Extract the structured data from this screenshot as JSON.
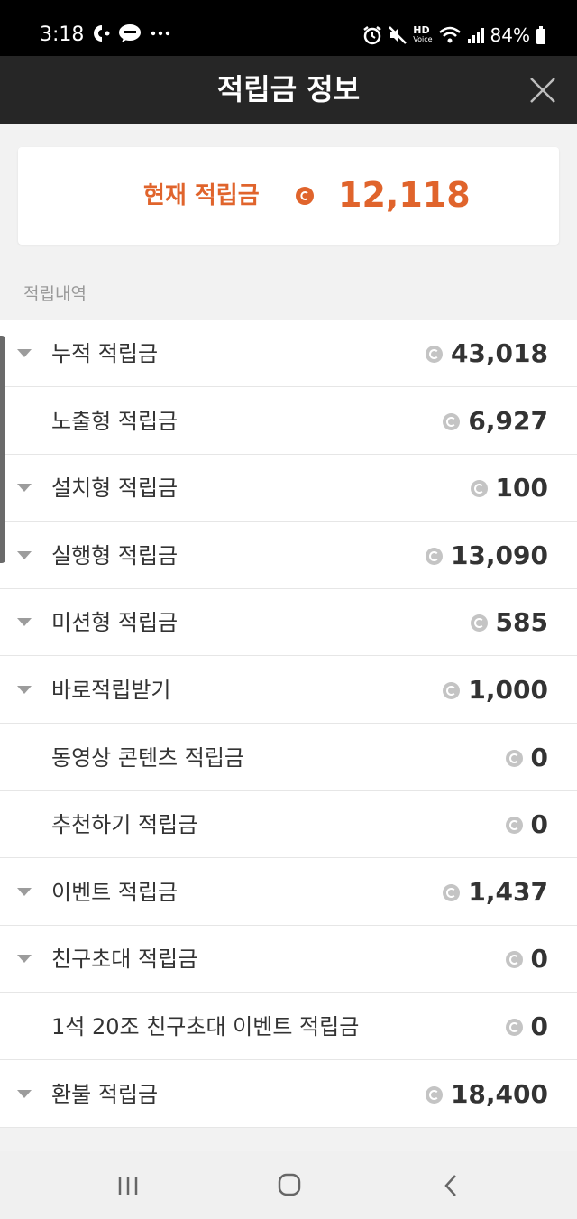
{
  "status_bar": {
    "time": "3:18",
    "battery": "84%",
    "icons": [
      "kakao-icon",
      "talk-icon",
      "more-icon",
      "alarm-icon",
      "mute-icon",
      "hd-voice-icon",
      "wifi-icon",
      "signal-icon",
      "battery-icon"
    ],
    "hd_top": "HD",
    "hd_bottom": "Voice"
  },
  "header": {
    "title": "적립금 정보",
    "close_icon": "close-icon"
  },
  "current": {
    "label": "현재 적립금",
    "amount": "12,118",
    "accent_color": "#e0642c"
  },
  "section_label": "적립내역",
  "rows": [
    {
      "label": "누적 적립금",
      "amount": "43,018",
      "expandable": true
    },
    {
      "label": "노출형 적립금",
      "amount": "6,927",
      "expandable": false
    },
    {
      "label": "설치형 적립금",
      "amount": "100",
      "expandable": true
    },
    {
      "label": "실행형 적립금",
      "amount": "13,090",
      "expandable": true
    },
    {
      "label": "미션형 적립금",
      "amount": "585",
      "expandable": true
    },
    {
      "label": "바로적립받기",
      "amount": "1,000",
      "expandable": true
    },
    {
      "label": "동영상 콘텐츠 적립금",
      "amount": "0",
      "expandable": false
    },
    {
      "label": "추천하기 적립금",
      "amount": "0",
      "expandable": false
    },
    {
      "label": "이벤트 적립금",
      "amount": "1,437",
      "expandable": true
    },
    {
      "label": "친구초대 적립금",
      "amount": "0",
      "expandable": true
    },
    {
      "label": "1석 20조 친구초대 이벤트 적립금",
      "amount": "0",
      "expandable": false
    },
    {
      "label": "환불 적립금",
      "amount": "18,400",
      "expandable": true
    }
  ],
  "nav": {
    "recents": "recents-icon",
    "home": "home-icon",
    "back": "back-icon"
  }
}
